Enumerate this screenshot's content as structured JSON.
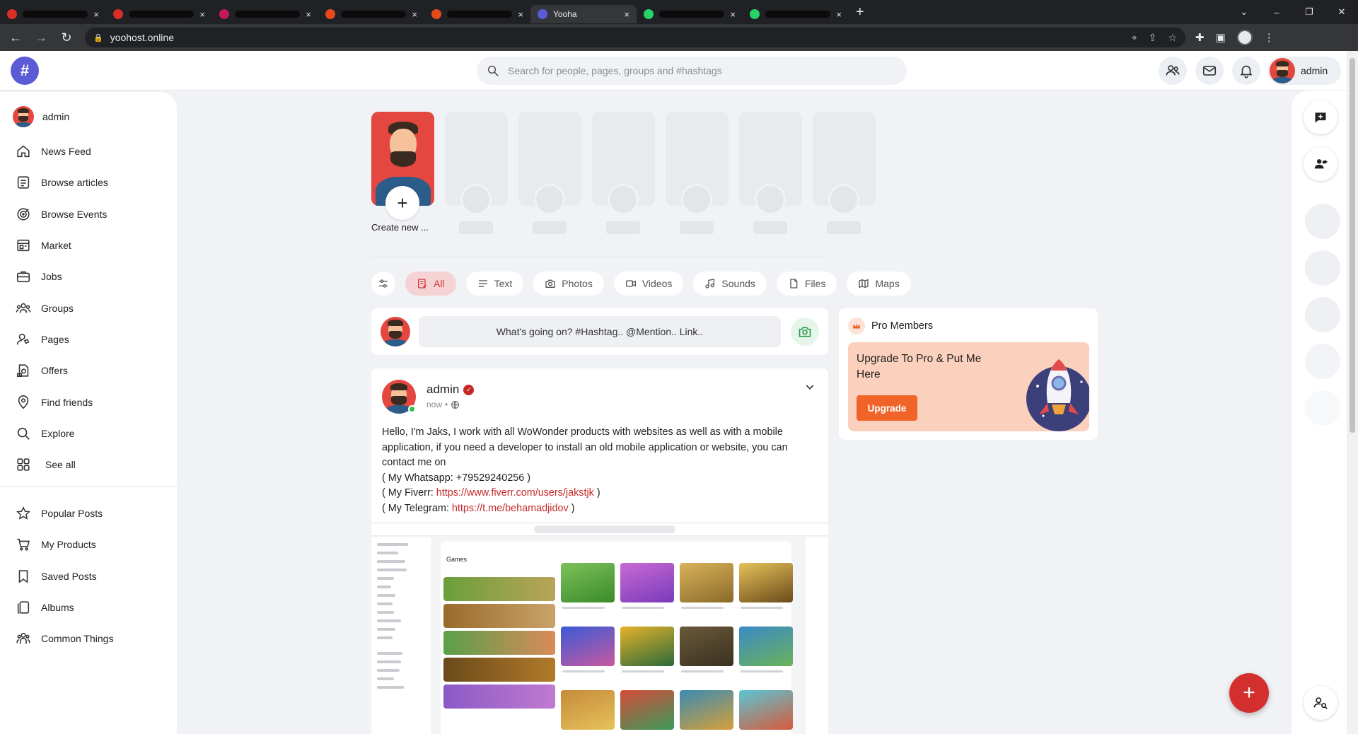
{
  "browser": {
    "active_tab_title": "Yooha",
    "url": "yoohost.online"
  },
  "header": {
    "search_placeholder": "Search for people, pages, groups and #hashtags",
    "user_name": "admin"
  },
  "sidebar": {
    "user_name": "admin",
    "items": [
      {
        "label": "News Feed",
        "icon": "home-icon"
      },
      {
        "label": "Browse articles",
        "icon": "article-icon"
      },
      {
        "label": "Browse Events",
        "icon": "target-icon"
      },
      {
        "label": "Market",
        "icon": "store-icon"
      },
      {
        "label": "Jobs",
        "icon": "briefcase-icon"
      },
      {
        "label": "Groups",
        "icon": "groups-icon"
      },
      {
        "label": "Pages",
        "icon": "pages-icon"
      },
      {
        "label": "Offers",
        "icon": "offer-icon"
      },
      {
        "label": "Find friends",
        "icon": "location-icon"
      },
      {
        "label": "Explore",
        "icon": "search-icon"
      },
      {
        "label": "See all",
        "icon": "grid-icon"
      }
    ],
    "secondary": [
      {
        "label": "Popular Posts",
        "icon": "star-icon"
      },
      {
        "label": "My Products",
        "icon": "cart-icon"
      },
      {
        "label": "Saved Posts",
        "icon": "bookmark-icon"
      },
      {
        "label": "Albums",
        "icon": "albums-icon"
      },
      {
        "label": "Common Things",
        "icon": "people-icon"
      }
    ]
  },
  "stories": {
    "create_label": "Create new ..."
  },
  "filters": [
    {
      "label": "All",
      "icon": "all-icon"
    },
    {
      "label": "Text",
      "icon": "text-icon"
    },
    {
      "label": "Photos",
      "icon": "camera-icon"
    },
    {
      "label": "Videos",
      "icon": "video-icon"
    },
    {
      "label": "Sounds",
      "icon": "music-icon"
    },
    {
      "label": "Files",
      "icon": "file-icon"
    },
    {
      "label": "Maps",
      "icon": "map-icon"
    }
  ],
  "publisher": {
    "placeholder": "What's going on? #Hashtag.. @Mention.. Link.."
  },
  "post": {
    "author": "admin",
    "time": "now",
    "line1": "Hello, I'm Jaks, I work with all WoWonder products with websites as well as with a mobile application, if you need a developer to install an old mobile application or website, you can contact me on",
    "line2": "( My Whatsapp: +79529240256 )",
    "fiverr_prefix": "( My Fiverr: ",
    "fiverr_link": "https://www.fiverr.com/users/jakstjk",
    "fiverr_suffix": " )",
    "telegram_prefix": "( My Telegram: ",
    "telegram_link": "https://t.me/behamadjidov",
    "telegram_suffix": " )",
    "image_title": "Games"
  },
  "pro_members": {
    "title": "Pro Members",
    "card_text": "Upgrade To Pro & Put Me Here",
    "button": "Upgrade"
  },
  "colors": {
    "accent": "#d32f2f",
    "brand": "#5b5bd6",
    "upgrade": "#f0642a"
  }
}
